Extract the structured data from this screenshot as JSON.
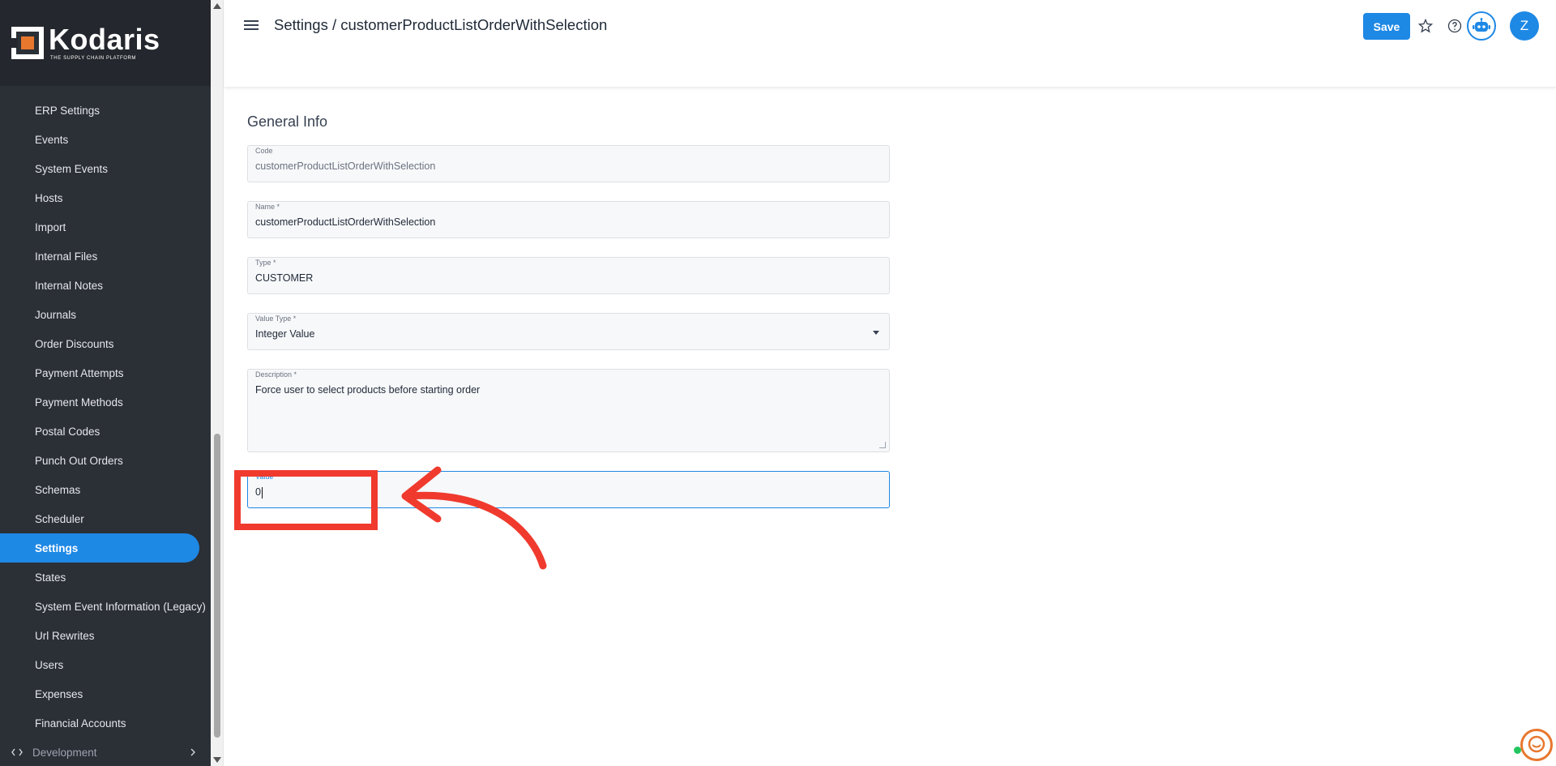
{
  "brand": {
    "name": "Kodaris",
    "tagline": "THE SUPPLY CHAIN PLATFORM",
    "accent": "#1e88e5",
    "logo_color": "#e8772e"
  },
  "sidebar": {
    "items": [
      {
        "label": "ERP Settings",
        "active": false
      },
      {
        "label": "Events",
        "active": false
      },
      {
        "label": "System Events",
        "active": false
      },
      {
        "label": "Hosts",
        "active": false
      },
      {
        "label": "Import",
        "active": false
      },
      {
        "label": "Internal Files",
        "active": false
      },
      {
        "label": "Internal Notes",
        "active": false
      },
      {
        "label": "Journals",
        "active": false
      },
      {
        "label": "Order Discounts",
        "active": false
      },
      {
        "label": "Payment Attempts",
        "active": false
      },
      {
        "label": "Payment Methods",
        "active": false
      },
      {
        "label": "Postal Codes",
        "active": false
      },
      {
        "label": "Punch Out Orders",
        "active": false
      },
      {
        "label": "Schemas",
        "active": false
      },
      {
        "label": "Scheduler",
        "active": false
      },
      {
        "label": "Settings",
        "active": true
      },
      {
        "label": "States",
        "active": false
      },
      {
        "label": "System Event Information (Legacy)",
        "active": false
      },
      {
        "label": "Url Rewrites",
        "active": false
      },
      {
        "label": "Users",
        "active": false
      },
      {
        "label": "Expenses",
        "active": false
      },
      {
        "label": "Financial Accounts",
        "active": false
      }
    ],
    "development": {
      "label": "Development",
      "icon": "code-icon",
      "chevron": "chevron-right-icon"
    }
  },
  "header": {
    "title": "Settings / customerProductListOrderWithSelection",
    "save_label": "Save",
    "avatar_initial": "Z",
    "icons": [
      "menu-icon",
      "star-icon",
      "help-icon",
      "bot-icon"
    ]
  },
  "form": {
    "section_title": "General Info",
    "code": {
      "label": "Code",
      "value": "customerProductListOrderWithSelection"
    },
    "name": {
      "label": "Name *",
      "value": "customerProductListOrderWithSelection"
    },
    "type": {
      "label": "Type *",
      "value": "CUSTOMER"
    },
    "value_type": {
      "label": "Value Type *",
      "value": "Integer Value"
    },
    "description": {
      "label": "Description *",
      "value": "Force user to select products before starting order"
    },
    "value": {
      "label": "Value",
      "value": "0"
    }
  },
  "annotation": {
    "color": "#f03a2e"
  }
}
